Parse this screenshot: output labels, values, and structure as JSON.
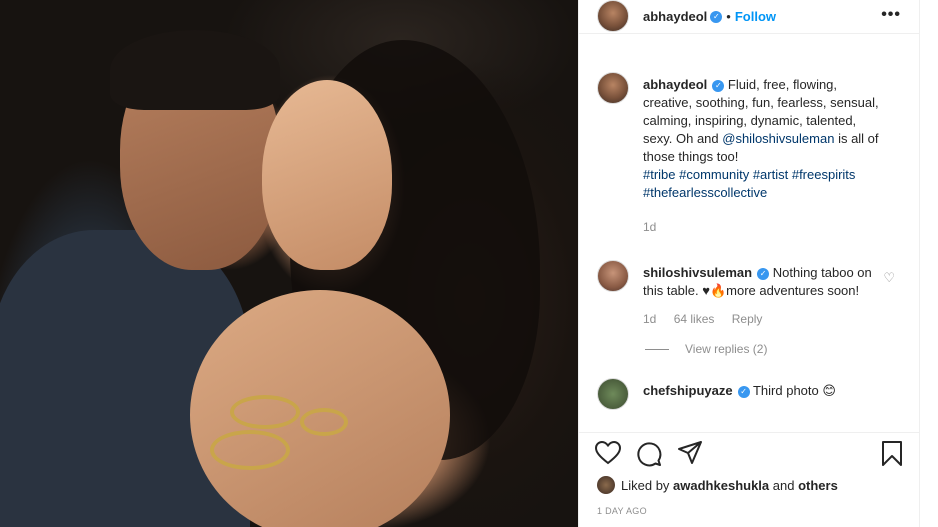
{
  "photo": {
    "alt": ""
  },
  "header": {
    "username": "abhaydeol",
    "separator": "•",
    "follow_label": "Follow",
    "more_icon": "more-icon"
  },
  "caption": {
    "username": "abhaydeol",
    "text_before": "Fluid, free, flowing, creative, soothing, fun, fearless, sensual, calming, inspiring, dynamic, talented, sexy. Oh and ",
    "mention": "@shiloshivsuleman",
    "text_after": " is all of those things too!",
    "tags": "#tribe #community #artist #freespirits #thefearlesscollective",
    "time": "1d"
  },
  "comments": [
    {
      "username": "shiloshivsuleman",
      "text": "Nothing taboo on this table. ♥🔥more adventures soon!",
      "time": "1d",
      "likes": "64 likes",
      "reply_label": "Reply",
      "view_replies": "View replies (2)"
    },
    {
      "username": "chefshipuyaze",
      "text": "Third photo 😊"
    }
  ],
  "liked_by": {
    "prefix": "Liked by ",
    "user": "awadhkeshukla",
    "middle": " and ",
    "others": "others"
  },
  "time_ago": "1 DAY AGO",
  "colors": {
    "accent": "#0095f6",
    "verified": "#3897f0",
    "muted": "#8e8e8e"
  }
}
